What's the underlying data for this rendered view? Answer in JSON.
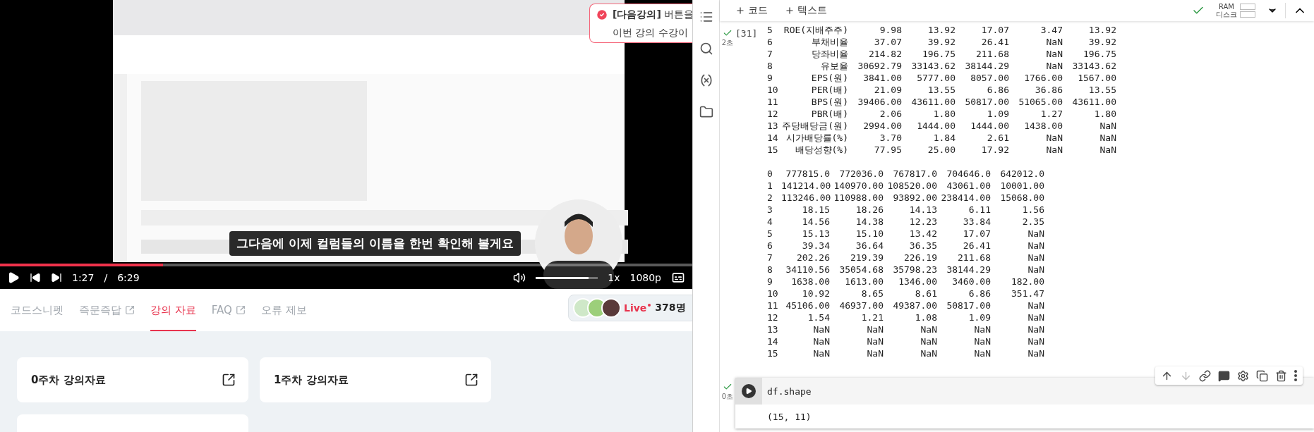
{
  "video": {
    "subtitle": "그다음에 이제 컬럼들의 이름을 한번 확인해 볼게요",
    "elapsed": "1:27",
    "separator": "/",
    "duration": "6:29",
    "progress": {
      "level": 0.235
    },
    "volume": {
      "level": 0.85
    },
    "speed": "1x",
    "quality": "1080p"
  },
  "toast": {
    "line_1": "**[다음강의]** 버튼을",
    "line_2": "이번 강의 수강이"
  },
  "tabs": [
    {
      "label": "코드스니펫",
      "selected": false,
      "external": false
    },
    {
      "label": "즉문즉답",
      "selected": false,
      "external": true
    },
    {
      "label": "강의 자료",
      "selected": true,
      "external": false
    },
    {
      "label": "FAQ",
      "selected": false,
      "external": true
    },
    {
      "label": "오류 제보",
      "selected": false,
      "external": false
    }
  ],
  "live": {
    "label": "Live",
    "count": "378명"
  },
  "cards": [
    {
      "kind": "full",
      "title": "0주차 강의자료"
    },
    {
      "kind": "full",
      "title": "1주차 강의자료"
    },
    {
      "kind": "cut"
    }
  ],
  "notebook": {
    "toolbar": {
      "add_code": "코드",
      "add_text": "텍스트",
      "ram_label": "RAM",
      "disk_label": "디스크"
    },
    "cells": [
      {
        "kind": "output",
        "done": true,
        "time": "2초",
        "exec_count": "[31]",
        "tables": [
          {
            "kind": "labeled",
            "rows": [
              {
                "index": "5",
                "label": "ROE(지배주주)",
                "values": [
                  "9.98",
                  "13.92",
                  "17.07",
                  "3.47",
                  "13.92"
                ]
              },
              {
                "index": "6",
                "label": "부채비율",
                "values": [
                  "37.07",
                  "39.92",
                  "26.41",
                  "NaN",
                  "39.92"
                ]
              },
              {
                "index": "7",
                "label": "당좌비율",
                "values": [
                  "214.82",
                  "196.75",
                  "211.68",
                  "NaN",
                  "196.75"
                ]
              },
              {
                "index": "8",
                "label": "유보율",
                "values": [
                  "30692.79",
                  "33143.62",
                  "38144.29",
                  "NaN",
                  "33143.62"
                ]
              },
              {
                "index": "9",
                "label": "EPS(원)",
                "values": [
                  "3841.00",
                  "5777.00",
                  "8057.00",
                  "1766.00",
                  "1567.00"
                ]
              },
              {
                "index": "10",
                "label": "PER(배)",
                "values": [
                  "21.09",
                  "13.55",
                  "6.86",
                  "36.86",
                  "13.55"
                ]
              },
              {
                "index": "11",
                "label": "BPS(원)",
                "values": [
                  "39406.00",
                  "43611.00",
                  "50817.00",
                  "51065.00",
                  "43611.00"
                ]
              },
              {
                "index": "12",
                "label": "PBR(배)",
                "values": [
                  "2.06",
                  "1.80",
                  "1.09",
                  "1.27",
                  "1.80"
                ]
              },
              {
                "index": "13",
                "label": "주당배당금(원)",
                "values": [
                  "2994.00",
                  "1444.00",
                  "1444.00",
                  "1438.00",
                  "NaN"
                ]
              },
              {
                "index": "14",
                "label": "시가배당률(%)",
                "values": [
                  "3.70",
                  "1.84",
                  "2.61",
                  "NaN",
                  "NaN"
                ]
              },
              {
                "index": "15",
                "label": "배당성향(%)",
                "values": [
                  "77.95",
                  "25.00",
                  "17.92",
                  "NaN",
                  "NaN"
                ]
              }
            ]
          },
          {
            "kind": "plain",
            "rows": [
              {
                "index": "0",
                "values": [
                  "777815.0",
                  "772036.0",
                  "767817.0",
                  "704646.0",
                  "642012.0"
                ]
              },
              {
                "index": "1",
                "values": [
                  "141214.00",
                  "140970.00",
                  "108520.00",
                  "43061.00",
                  "10001.00"
                ]
              },
              {
                "index": "2",
                "values": [
                  "113246.00",
                  "110988.00",
                  "93892.00",
                  "238414.00",
                  "15068.00"
                ]
              },
              {
                "index": "3",
                "values": [
                  "18.15",
                  "18.26",
                  "14.13",
                  "6.11",
                  "1.56"
                ]
              },
              {
                "index": "4",
                "values": [
                  "14.56",
                  "14.38",
                  "12.23",
                  "33.84",
                  "2.35"
                ]
              },
              {
                "index": "5",
                "values": [
                  "15.13",
                  "15.10",
                  "13.42",
                  "17.07",
                  "NaN"
                ]
              },
              {
                "index": "6",
                "values": [
                  "39.34",
                  "36.64",
                  "36.35",
                  "26.41",
                  "NaN"
                ]
              },
              {
                "index": "7",
                "values": [
                  "202.26",
                  "219.39",
                  "226.19",
                  "211.68",
                  "NaN"
                ]
              },
              {
                "index": "8",
                "values": [
                  "34110.56",
                  "35054.68",
                  "35798.23",
                  "38144.29",
                  "NaN"
                ]
              },
              {
                "index": "9",
                "values": [
                  "1638.00",
                  "1613.00",
                  "1346.00",
                  "3460.00",
                  "182.00"
                ]
              },
              {
                "index": "10",
                "values": [
                  "10.92",
                  "8.65",
                  "8.61",
                  "6.86",
                  "351.47"
                ]
              },
              {
                "index": "11",
                "values": [
                  "45106.00",
                  "46937.00",
                  "49387.00",
                  "50817.00",
                  "NaN"
                ]
              },
              {
                "index": "12",
                "values": [
                  "1.54",
                  "1.21",
                  "1.08",
                  "1.09",
                  "NaN"
                ]
              },
              {
                "index": "13",
                "values": [
                  "NaN",
                  "NaN",
                  "NaN",
                  "NaN",
                  "NaN"
                ]
              },
              {
                "index": "14",
                "values": [
                  "NaN",
                  "NaN",
                  "NaN",
                  "NaN",
                  "NaN"
                ]
              },
              {
                "index": "15",
                "values": [
                  "NaN",
                  "NaN",
                  "NaN",
                  "NaN",
                  "NaN"
                ]
              }
            ]
          }
        ]
      },
      {
        "kind": "code",
        "done": true,
        "time": "0초",
        "code": "df.shape",
        "output": "(15, 11)"
      }
    ]
  }
}
